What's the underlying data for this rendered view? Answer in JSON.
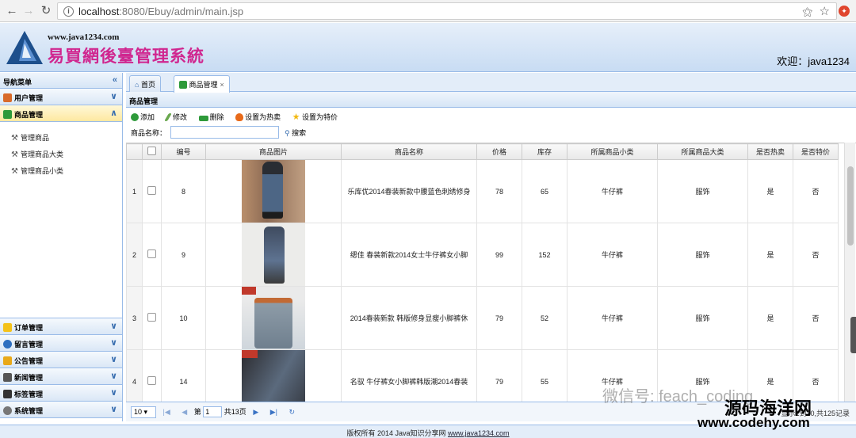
{
  "browser": {
    "url_host": "localhost",
    "url_path": ":8080/Ebuy/admin/main.jsp"
  },
  "header": {
    "site": "www.java1234.com",
    "title": "易買網後臺管理系統",
    "welcome": "欢迎：java1234"
  },
  "sidebar": {
    "title": "导航菜单",
    "sections": [
      {
        "label": "用户管理",
        "icon": "user-icon",
        "color": "#d86a2a"
      },
      {
        "label": "商品管理",
        "icon": "product-icon",
        "color": "#2e9a3a",
        "active": true,
        "items": [
          "管理商品",
          "管理商品大类",
          "管理商品小类"
        ]
      },
      {
        "label": "订单管理",
        "icon": "order-icon",
        "color": "#f4c21a"
      },
      {
        "label": "留言管理",
        "icon": "message-icon",
        "color": "#2e6fc0"
      },
      {
        "label": "公告管理",
        "icon": "notice-icon",
        "color": "#e9a91a"
      },
      {
        "label": "新闻管理",
        "icon": "news-icon",
        "color": "#555555"
      },
      {
        "label": "标签管理",
        "icon": "tag-icon",
        "color": "#333333"
      },
      {
        "label": "系统管理",
        "icon": "system-icon",
        "color": "#777777"
      }
    ]
  },
  "tabs": [
    {
      "label": "首页",
      "icon": "home-icon"
    },
    {
      "label": "商品管理",
      "icon": "product-icon",
      "closable": true
    }
  ],
  "panel": {
    "title": "商品管理",
    "toolbar": [
      "添加",
      "修改",
      "删除",
      "设置为热卖",
      "设置为特价"
    ],
    "search_label": "商品名称：",
    "search_button": "搜索"
  },
  "grid": {
    "columns": [
      "编号",
      "商品图片",
      "商品名称",
      "价格",
      "库存",
      "所属商品小类",
      "所属商品大类",
      "是否热卖",
      "是否特价"
    ],
    "rows": [
      {
        "rn": "1",
        "id": "8",
        "name": "乐库优2014春装新款中腰蓝色刺绣修身",
        "price": "78",
        "stock": "65",
        "small": "牛仔裤",
        "big": "服饰",
        "hot": "是",
        "special": "否"
      },
      {
        "rn": "2",
        "id": "9",
        "name": "缌佳 春装新款2014女士牛仔裤女小脚",
        "price": "99",
        "stock": "152",
        "small": "牛仔裤",
        "big": "服饰",
        "hot": "是",
        "special": "否"
      },
      {
        "rn": "3",
        "id": "10",
        "name": "2014春装新款 韩版修身显瘦小脚裤休",
        "price": "79",
        "stock": "52",
        "small": "牛仔裤",
        "big": "服饰",
        "hot": "是",
        "special": "否"
      },
      {
        "rn": "4",
        "id": "14",
        "name": "名驭 牛仔裤女小脚裤韩版潮2014春装",
        "price": "79",
        "stock": "55",
        "small": "牛仔裤",
        "big": "服饰",
        "hot": "是",
        "special": "否"
      }
    ]
  },
  "pager": {
    "page_size": "10",
    "page_prefix": "第",
    "page": "1",
    "page_suffix": "共13页",
    "summary": "显示1到10,共125记录"
  },
  "footer": {
    "text": "版权所有 2014 Java知识分享网 ",
    "link": "www.java1234.com"
  },
  "watermarks": {
    "wechat": "微信号: feach_coding",
    "site_cn": "源码海洋网",
    "site_url": "www.codehy.com"
  }
}
